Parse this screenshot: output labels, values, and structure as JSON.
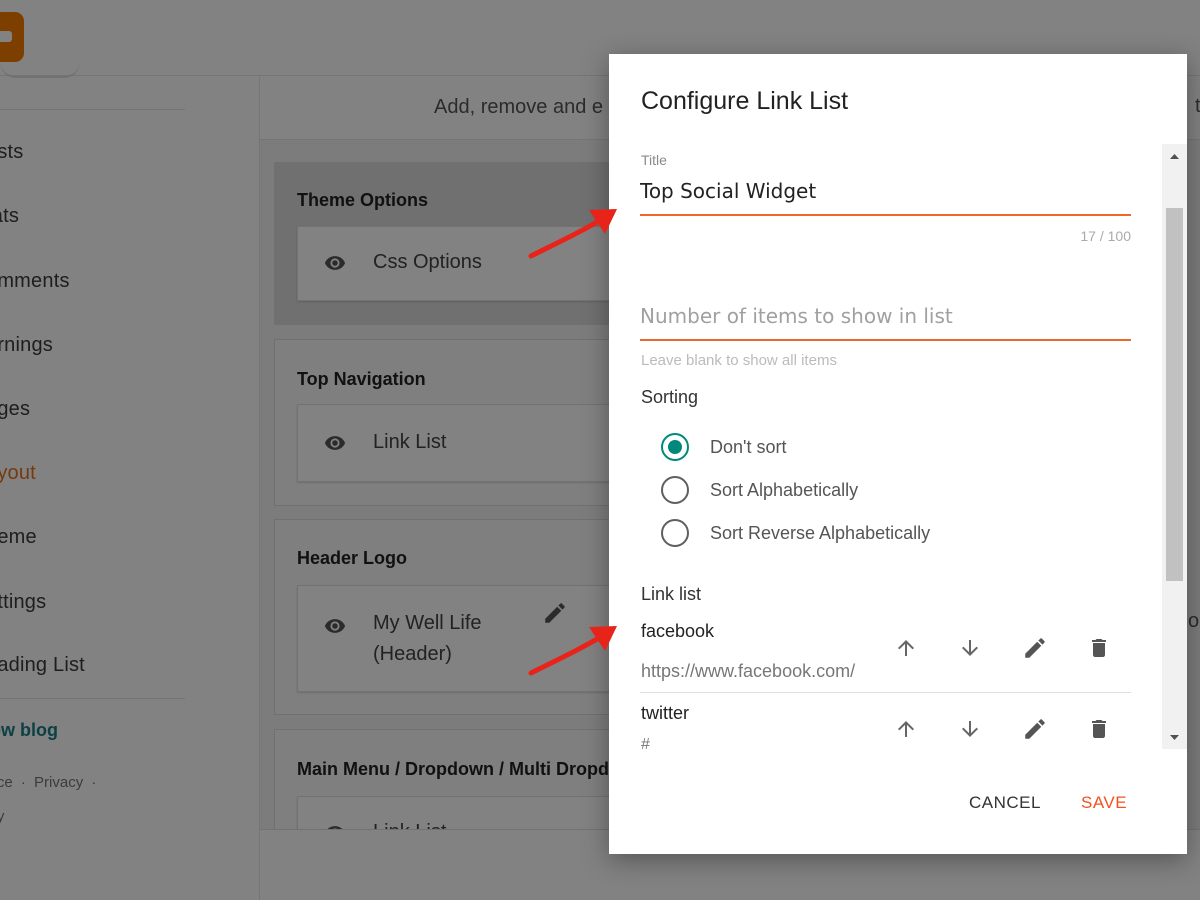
{
  "sidebar": {
    "items": [
      {
        "label": "osts"
      },
      {
        "label": "tats"
      },
      {
        "label": "omments"
      },
      {
        "label": "arnings"
      },
      {
        "label": "ages"
      },
      {
        "label": "ayout"
      },
      {
        "label": "heme"
      },
      {
        "label": "ettings"
      },
      {
        "label": "eading List"
      }
    ],
    "view_blog": "iew blog",
    "footer": {
      "service": "vice",
      "sep1": "·",
      "privacy": "Privacy",
      "sep2": "·",
      "policy": "icy"
    }
  },
  "main": {
    "description": "Add, remove and e",
    "right_edge_text": "o",
    "right_edge_text2": "t",
    "sections": [
      {
        "title": "Theme Options",
        "gadget": {
          "label": "Css Options"
        }
      },
      {
        "title": "Top Navigation",
        "gadget": {
          "label": "Link List"
        }
      },
      {
        "title": "Header Logo",
        "gadget": {
          "label_line1": "My Well Life",
          "label_line2": "(Header)"
        }
      },
      {
        "title": "Main Menu / Dropdown / Multi Dropdo",
        "gadget": {
          "label": "Link List"
        }
      }
    ]
  },
  "dialog": {
    "title": "Configure Link List",
    "title_field": {
      "label": "Title",
      "value": "Top Social Widget",
      "char_count": "17 / 100"
    },
    "items_field": {
      "placeholder": "Number of items to show in list",
      "value": "",
      "helper": "Leave blank to show all items"
    },
    "sorting": {
      "label": "Sorting",
      "options": [
        {
          "label": "Don't sort",
          "checked": true
        },
        {
          "label": "Sort Alphabetically",
          "checked": false
        },
        {
          "label": "Sort Reverse Alphabetically",
          "checked": false
        }
      ]
    },
    "link_list": {
      "label": "Link list",
      "links": [
        {
          "name": "facebook",
          "url": "https://www.facebook.com/"
        },
        {
          "name": "twitter",
          "url": "#"
        }
      ]
    },
    "actions": {
      "cancel": "CANCEL",
      "save": "SAVE"
    }
  },
  "colors": {
    "accent_orange": "#f0672b",
    "radio_teal": "#00897b",
    "save_text": "#f4511e",
    "annotation_red": "#e8241a",
    "layout_active": "#e8711a"
  }
}
